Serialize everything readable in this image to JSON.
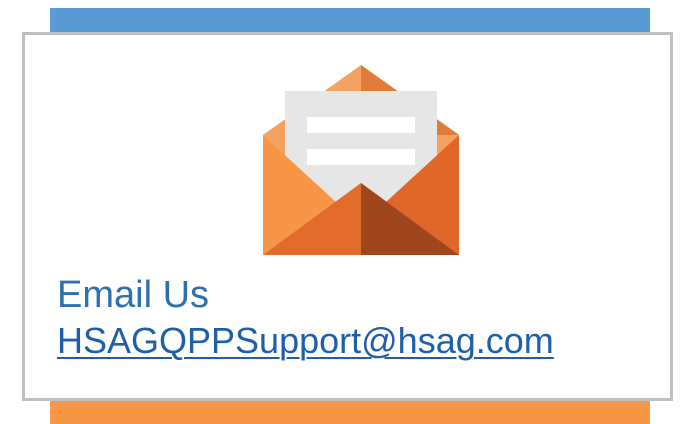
{
  "contact": {
    "title": "Email Us",
    "email": "HSAGQPPSupport@hsag.com",
    "icon": "email-envelope-icon"
  },
  "colors": {
    "top_bar": "#5b9bd5",
    "bottom_bar": "#f79646",
    "title_text": "#2e6fb0",
    "link_text": "#1f5fa8",
    "envelope_orange": "#f79646",
    "envelope_dark": "#a0461f",
    "letter": "#e6e6e6"
  }
}
